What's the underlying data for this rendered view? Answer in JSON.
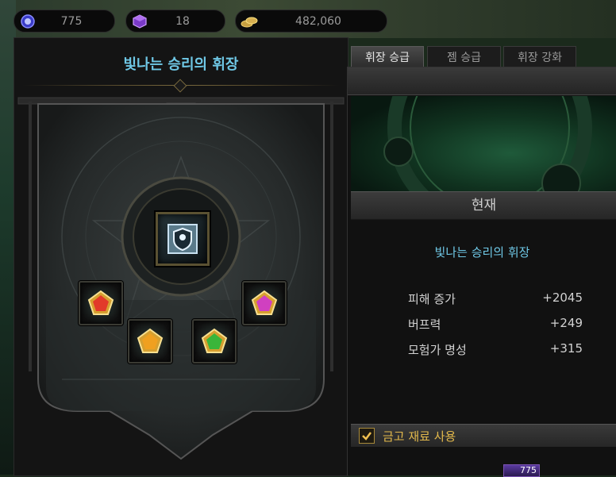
{
  "currencies": [
    {
      "icon": "blue-orb-icon",
      "value": "775"
    },
    {
      "icon": "purple-cube-icon",
      "value": "18"
    },
    {
      "icon": "gold-coins-icon",
      "value": "482,060"
    }
  ],
  "left_panel": {
    "title": "빛나는 승리의 휘장",
    "center_emblem": "shield-emblem-icon",
    "gems": [
      {
        "name": "red-gem",
        "color": "#e23a2a"
      },
      {
        "name": "orange-gem",
        "color": "#f0a020"
      },
      {
        "name": "green-gem",
        "color": "#3ab53a"
      },
      {
        "name": "magenta-gem",
        "color": "#d040c0"
      }
    ]
  },
  "tabs": [
    {
      "label": "휘장 승급",
      "active": true
    },
    {
      "label": "젬 승급",
      "active": false
    },
    {
      "label": "휘장 강화",
      "active": false
    }
  ],
  "right_panel": {
    "section_header": "현재",
    "current_name": "빛나는 승리의 휘장",
    "stats": [
      {
        "label": "피해 증가",
        "value": "+2045"
      },
      {
        "label": "버프력",
        "value": "+249"
      },
      {
        "label": "모험가 명성",
        "value": "+315"
      }
    ],
    "option_label": "금고 재료 사용",
    "option_checked": true,
    "material_count": "775"
  },
  "colors": {
    "title_cyan": "#6fc8e6",
    "gold": "#e3b94c"
  }
}
